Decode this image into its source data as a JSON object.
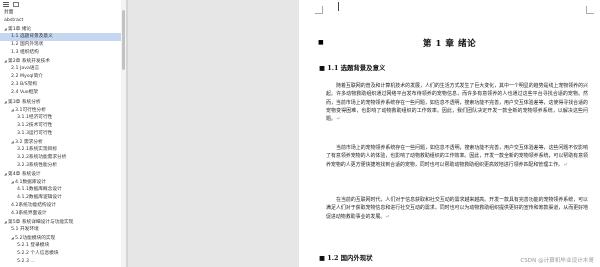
{
  "nav": {
    "items": [
      {
        "label": "封面",
        "level": 0,
        "caret": false,
        "selected": false
      },
      {
        "label": "abstract",
        "level": 0,
        "caret": false,
        "selected": false
      },
      {
        "label": "第1章 绪论",
        "level": 1,
        "caret": true,
        "selected": false
      },
      {
        "label": "1.1 选题背景及意义",
        "level": 2,
        "caret": false,
        "selected": true
      },
      {
        "label": "1.2 国内外现状",
        "level": 2,
        "caret": false,
        "selected": false
      },
      {
        "label": "1.3 组织结构",
        "level": 2,
        "caret": false,
        "selected": false
      },
      {
        "label": "第2章 系统开发技术",
        "level": 1,
        "caret": true,
        "selected": false
      },
      {
        "label": "2.1 Java语言",
        "level": 2,
        "caret": false,
        "selected": false
      },
      {
        "label": "2.2 Mysql简介",
        "level": 2,
        "caret": false,
        "selected": false
      },
      {
        "label": "2.3 B/S架构",
        "level": 2,
        "caret": false,
        "selected": false
      },
      {
        "label": "2.4 Vue框架",
        "level": 2,
        "caret": false,
        "selected": false
      },
      {
        "label": "第3章 系统分析",
        "level": 1,
        "caret": true,
        "selected": false
      },
      {
        "label": "3.1可行性分析",
        "level": 2,
        "caret": true,
        "selected": false
      },
      {
        "label": "3.1.1经济可行性",
        "level": 3,
        "caret": false,
        "selected": false
      },
      {
        "label": "3.1.2技术可行性",
        "level": 3,
        "caret": false,
        "selected": false
      },
      {
        "label": "3.1.3运行可行性",
        "level": 3,
        "caret": false,
        "selected": false
      },
      {
        "label": "3.2 需求分析",
        "level": 2,
        "caret": true,
        "selected": false
      },
      {
        "label": "3.2.1系统实现目标",
        "level": 3,
        "caret": false,
        "selected": false
      },
      {
        "label": "3.2.2系统功能需求分析",
        "level": 3,
        "caret": false,
        "selected": false
      },
      {
        "label": "3.2.3系统性能分析",
        "level": 3,
        "caret": false,
        "selected": false
      },
      {
        "label": "第4章 系统设计",
        "level": 1,
        "caret": true,
        "selected": false
      },
      {
        "label": "4.1数据库设计",
        "level": 2,
        "caret": true,
        "selected": false
      },
      {
        "label": "4.1.1数据库概念设计",
        "level": 3,
        "caret": false,
        "selected": false
      },
      {
        "label": "4.1.2数据库逻辑设计",
        "level": 3,
        "caret": false,
        "selected": false
      },
      {
        "label": "4.2系统功能结构设计",
        "level": 2,
        "caret": false,
        "selected": false
      },
      {
        "label": "4.3系统界面设计",
        "level": 2,
        "caret": false,
        "selected": false
      },
      {
        "label": "第5章 系统详细设计与功能实现",
        "level": 1,
        "caret": true,
        "selected": false
      },
      {
        "label": "5.1 开发环境",
        "level": 2,
        "caret": false,
        "selected": false
      },
      {
        "label": "5.2功能模块的实现",
        "level": 2,
        "caret": true,
        "selected": false
      },
      {
        "label": "5.2.1 登录模块",
        "level": 3,
        "caret": false,
        "selected": false
      },
      {
        "label": "5.2.2 个人信息模块",
        "level": 3,
        "caret": false,
        "selected": false
      },
      {
        "label": "5.2.3 ...",
        "level": 3,
        "caret": false,
        "selected": false
      }
    ]
  },
  "document": {
    "chapter_title": "第 1 章  绪论",
    "bullet": "■",
    "section_1": "1.1  选题背景及意义",
    "paragraph_1": "随着互联网的普及和计算机技术的发展，人们的生活方式发生了巨大变化，其中一个明显的趋势是线上宠物领养的兴起。许多动物救助组织通过网络平台发布待领养的宠物信息，而许多有意领养的人也通过这些平台寻找合适的宠物。然而，当前市场上的宠物领养系统存在一些问题，如信息不透明，搜索功能不完善，用户交互体验差等，这使得寻找合适的宠物变得困难，也影响了动物救助组织的工作效率。因此，我们团队决定开发一款全新的宠物领养系统，以解决这些问题。",
    "paragraph_2": "当前市场上的宠物领养系统存在一些问题，如信息不透明，搜索功能不完善，用户交互体验差等，这些问题不仅影响了有意领养宠物的人的体验，也影响了动物救助组织的工作效率。因此，开发一款全新的宠物领养系统，可以帮助有意领养宠物的人更方便快捷地找到合适的宠物，同时也可以帮助动物救助组织更高效地进行领养匹配和管理工作。",
    "paragraph_3": "在当前的互联网时代，人们对于信息获取和社交互动的需求越来越高。开发一款具有完善功能的宠物领养系统，可以满足人们对于获取宠物信息和进行社交互动的需求，同时也可以为动物救助组织提供更好的宣传和筹款渠道，从而更好地促进动物救助事业的发展。",
    "para_mark": "↵",
    "section_2": "1.2  国内外现状"
  },
  "watermark": "CSDN @计算机毕业设计木哥"
}
